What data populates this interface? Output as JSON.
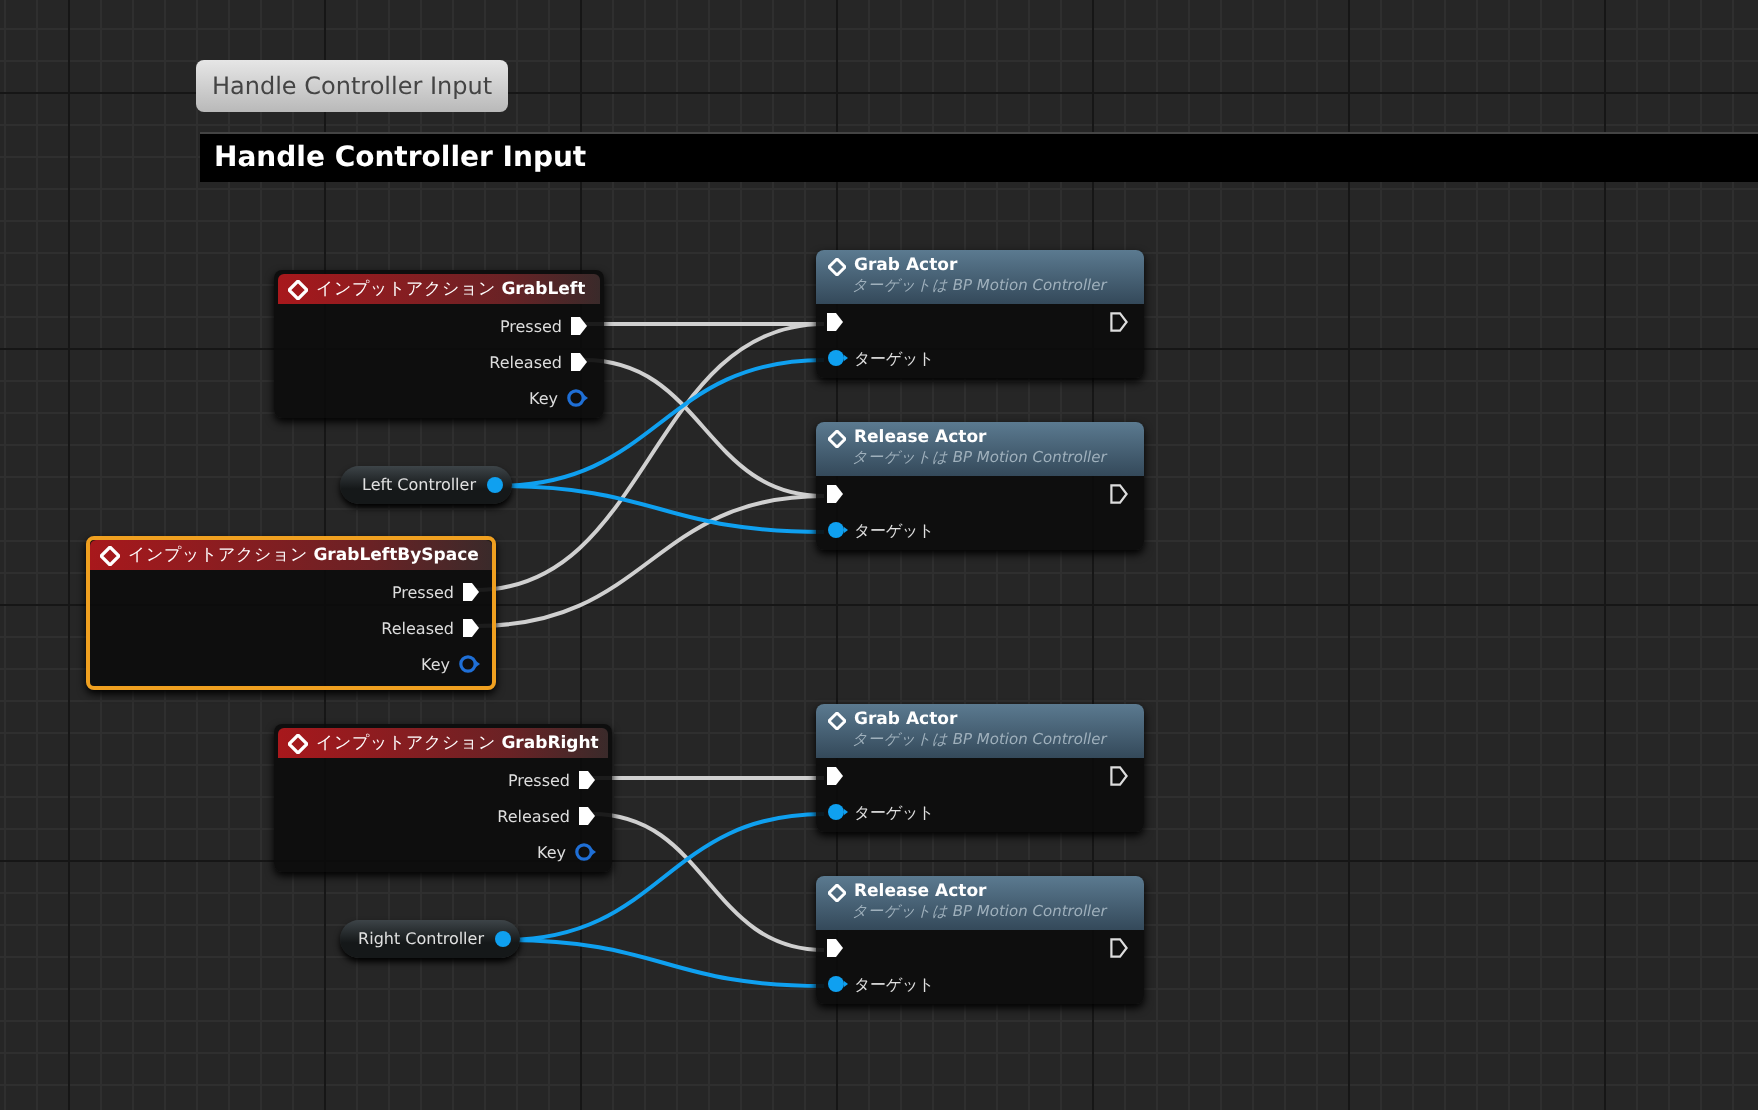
{
  "comment": {
    "bubble": "Handle Controller Input",
    "title": "Handle Controller Input"
  },
  "events": [
    {
      "title": "インプットアクション **GrabLeft**",
      "selected": false,
      "pins": [
        {
          "label": "Pressed",
          "kind": "exec"
        },
        {
          "label": "Released",
          "kind": "exec"
        },
        {
          "label": "Key",
          "kind": "key"
        }
      ]
    },
    {
      "title": "インプットアクション **GrabLeftBySpace**",
      "selected": true,
      "pins": [
        {
          "label": "Pressed",
          "kind": "exec"
        },
        {
          "label": "Released",
          "kind": "exec"
        },
        {
          "label": "Key",
          "kind": "key"
        }
      ]
    },
    {
      "title": "インプットアクション **GrabRight**",
      "selected": false,
      "pins": [
        {
          "label": "Pressed",
          "kind": "exec"
        },
        {
          "label": "Released",
          "kind": "exec"
        },
        {
          "label": "Key",
          "kind": "key"
        }
      ]
    }
  ],
  "variables": [
    {
      "label": "Left Controller"
    },
    {
      "label": "Right Controller"
    }
  ],
  "functions": [
    {
      "title": "Grab Actor",
      "subtitle": "ターゲットは BP Motion Controller",
      "target": "ターゲット"
    },
    {
      "title": "Release Actor",
      "subtitle": "ターゲットは BP Motion Controller",
      "target": "ターゲット"
    },
    {
      "title": "Grab Actor",
      "subtitle": "ターゲットは BP Motion Controller",
      "target": "ターゲット"
    },
    {
      "title": "Release Actor",
      "subtitle": "ターゲットは BP Motion Controller",
      "target": "ターゲット"
    }
  ]
}
